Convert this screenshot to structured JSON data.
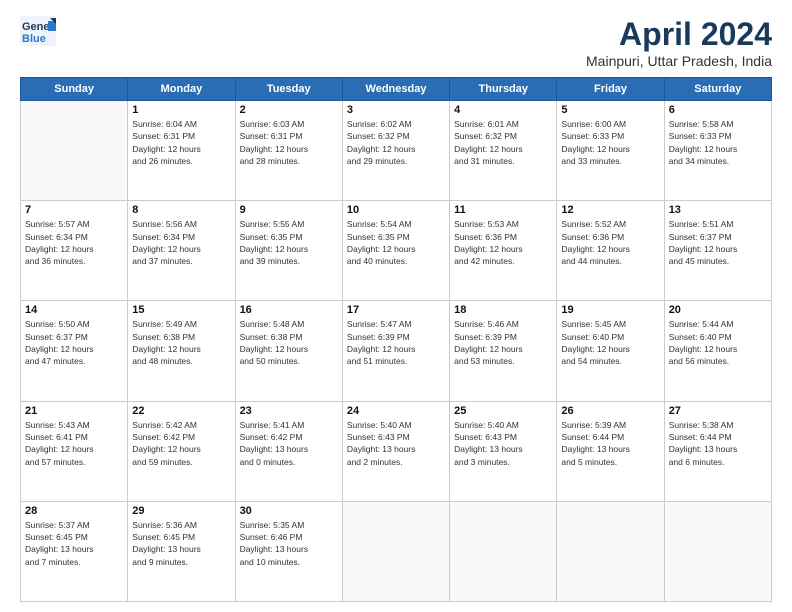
{
  "header": {
    "logo_line1": "General",
    "logo_line2": "Blue",
    "month": "April 2024",
    "location": "Mainpuri, Uttar Pradesh, India"
  },
  "weekdays": [
    "Sunday",
    "Monday",
    "Tuesday",
    "Wednesday",
    "Thursday",
    "Friday",
    "Saturday"
  ],
  "weeks": [
    [
      {
        "day": "",
        "info": ""
      },
      {
        "day": "1",
        "info": "Sunrise: 6:04 AM\nSunset: 6:31 PM\nDaylight: 12 hours\nand 26 minutes."
      },
      {
        "day": "2",
        "info": "Sunrise: 6:03 AM\nSunset: 6:31 PM\nDaylight: 12 hours\nand 28 minutes."
      },
      {
        "day": "3",
        "info": "Sunrise: 6:02 AM\nSunset: 6:32 PM\nDaylight: 12 hours\nand 29 minutes."
      },
      {
        "day": "4",
        "info": "Sunrise: 6:01 AM\nSunset: 6:32 PM\nDaylight: 12 hours\nand 31 minutes."
      },
      {
        "day": "5",
        "info": "Sunrise: 6:00 AM\nSunset: 6:33 PM\nDaylight: 12 hours\nand 33 minutes."
      },
      {
        "day": "6",
        "info": "Sunrise: 5:58 AM\nSunset: 6:33 PM\nDaylight: 12 hours\nand 34 minutes."
      }
    ],
    [
      {
        "day": "7",
        "info": "Sunrise: 5:57 AM\nSunset: 6:34 PM\nDaylight: 12 hours\nand 36 minutes."
      },
      {
        "day": "8",
        "info": "Sunrise: 5:56 AM\nSunset: 6:34 PM\nDaylight: 12 hours\nand 37 minutes."
      },
      {
        "day": "9",
        "info": "Sunrise: 5:55 AM\nSunset: 6:35 PM\nDaylight: 12 hours\nand 39 minutes."
      },
      {
        "day": "10",
        "info": "Sunrise: 5:54 AM\nSunset: 6:35 PM\nDaylight: 12 hours\nand 40 minutes."
      },
      {
        "day": "11",
        "info": "Sunrise: 5:53 AM\nSunset: 6:36 PM\nDaylight: 12 hours\nand 42 minutes."
      },
      {
        "day": "12",
        "info": "Sunrise: 5:52 AM\nSunset: 6:36 PM\nDaylight: 12 hours\nand 44 minutes."
      },
      {
        "day": "13",
        "info": "Sunrise: 5:51 AM\nSunset: 6:37 PM\nDaylight: 12 hours\nand 45 minutes."
      }
    ],
    [
      {
        "day": "14",
        "info": "Sunrise: 5:50 AM\nSunset: 6:37 PM\nDaylight: 12 hours\nand 47 minutes."
      },
      {
        "day": "15",
        "info": "Sunrise: 5:49 AM\nSunset: 6:38 PM\nDaylight: 12 hours\nand 48 minutes."
      },
      {
        "day": "16",
        "info": "Sunrise: 5:48 AM\nSunset: 6:38 PM\nDaylight: 12 hours\nand 50 minutes."
      },
      {
        "day": "17",
        "info": "Sunrise: 5:47 AM\nSunset: 6:39 PM\nDaylight: 12 hours\nand 51 minutes."
      },
      {
        "day": "18",
        "info": "Sunrise: 5:46 AM\nSunset: 6:39 PM\nDaylight: 12 hours\nand 53 minutes."
      },
      {
        "day": "19",
        "info": "Sunrise: 5:45 AM\nSunset: 6:40 PM\nDaylight: 12 hours\nand 54 minutes."
      },
      {
        "day": "20",
        "info": "Sunrise: 5:44 AM\nSunset: 6:40 PM\nDaylight: 12 hours\nand 56 minutes."
      }
    ],
    [
      {
        "day": "21",
        "info": "Sunrise: 5:43 AM\nSunset: 6:41 PM\nDaylight: 12 hours\nand 57 minutes."
      },
      {
        "day": "22",
        "info": "Sunrise: 5:42 AM\nSunset: 6:42 PM\nDaylight: 12 hours\nand 59 minutes."
      },
      {
        "day": "23",
        "info": "Sunrise: 5:41 AM\nSunset: 6:42 PM\nDaylight: 13 hours\nand 0 minutes."
      },
      {
        "day": "24",
        "info": "Sunrise: 5:40 AM\nSunset: 6:43 PM\nDaylight: 13 hours\nand 2 minutes."
      },
      {
        "day": "25",
        "info": "Sunrise: 5:40 AM\nSunset: 6:43 PM\nDaylight: 13 hours\nand 3 minutes."
      },
      {
        "day": "26",
        "info": "Sunrise: 5:39 AM\nSunset: 6:44 PM\nDaylight: 13 hours\nand 5 minutes."
      },
      {
        "day": "27",
        "info": "Sunrise: 5:38 AM\nSunset: 6:44 PM\nDaylight: 13 hours\nand 6 minutes."
      }
    ],
    [
      {
        "day": "28",
        "info": "Sunrise: 5:37 AM\nSunset: 6:45 PM\nDaylight: 13 hours\nand 7 minutes."
      },
      {
        "day": "29",
        "info": "Sunrise: 5:36 AM\nSunset: 6:45 PM\nDaylight: 13 hours\nand 9 minutes."
      },
      {
        "day": "30",
        "info": "Sunrise: 5:35 AM\nSunset: 6:46 PM\nDaylight: 13 hours\nand 10 minutes."
      },
      {
        "day": "",
        "info": ""
      },
      {
        "day": "",
        "info": ""
      },
      {
        "day": "",
        "info": ""
      },
      {
        "day": "",
        "info": ""
      }
    ]
  ]
}
